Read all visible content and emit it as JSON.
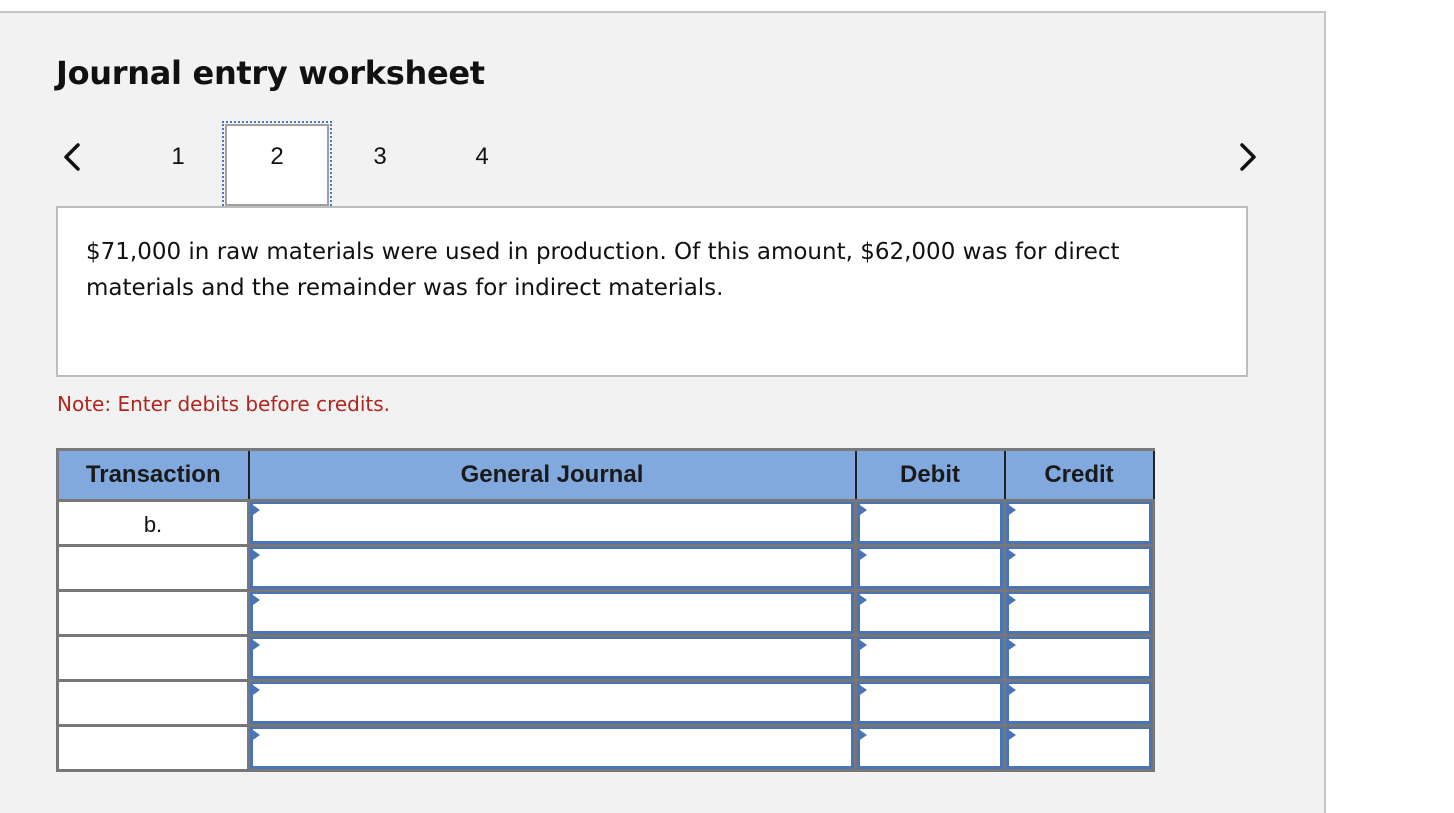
{
  "title": "Journal entry worksheet",
  "navigation": {
    "prev_icon": "chevron-left-icon",
    "next_icon": "chevron-right-icon",
    "pages": [
      "1",
      "2",
      "3",
      "4"
    ],
    "current_page": "2"
  },
  "description": "$71,000 in raw materials were used in production. Of this amount, $62,000 was for direct materials and the remainder was for indirect materials.",
  "note": "Note: Enter debits before credits.",
  "table": {
    "columns": [
      "Transaction",
      "General Journal",
      "Debit",
      "Credit"
    ],
    "rows": [
      {
        "transaction": "b.",
        "general_journal": "",
        "debit": "",
        "credit": ""
      },
      {
        "transaction": "",
        "general_journal": "",
        "debit": "",
        "credit": ""
      },
      {
        "transaction": "",
        "general_journal": "",
        "debit": "",
        "credit": ""
      },
      {
        "transaction": "",
        "general_journal": "",
        "debit": "",
        "credit": ""
      },
      {
        "transaction": "",
        "general_journal": "",
        "debit": "",
        "credit": ""
      },
      {
        "transaction": "",
        "general_journal": "",
        "debit": "",
        "credit": ""
      }
    ]
  },
  "colors": {
    "header_bg": "#82a9de",
    "input_border": "#4a74b5",
    "note_text": "#b0261e",
    "panel_bg": "#f2f2f2"
  }
}
